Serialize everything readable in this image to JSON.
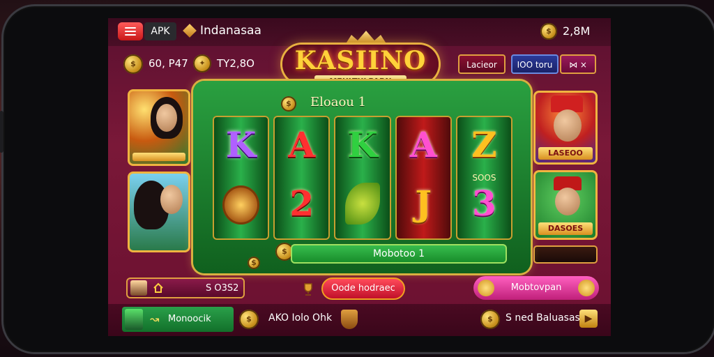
{
  "topbar": {
    "apk_label": "APK",
    "brand": "Indanasaa",
    "balance": "2,8M"
  },
  "stats": {
    "value1": "60, P47",
    "value2": "ΤΥ2,8O"
  },
  "logo": {
    "title": "KASIINO",
    "subtitle": "MEULTULPARN"
  },
  "top_buttons": {
    "btn1": "Lacieor",
    "btn2": "IOO toru",
    "btn3": "⋈ ×"
  },
  "reels": {
    "win_label": "Eloaou 1",
    "symbols_top": [
      "K",
      "A",
      "K",
      "A",
      "Z"
    ],
    "symbols_bottom": [
      "",
      "2",
      "",
      "J",
      "3"
    ],
    "reel5_note": "SOOS",
    "spin_label": "Mobotoo 1"
  },
  "cards": {
    "left1_label": "",
    "right1_label": "LASEOO",
    "right2_label": "DASOES"
  },
  "bottom_row": {
    "player_value": "S O3S2",
    "order_label": "Oode hodraec",
    "multi_label": "Mobtovpan"
  },
  "bottombar": {
    "green_label": "Monoocik",
    "mid_label": "AKO Iolo Ohk",
    "right_label": "S ned Baluasas"
  },
  "colors": {
    "accent_gold": "#f0b440",
    "frame_green": "#2aa040",
    "screen_bg": "#7a1838"
  }
}
